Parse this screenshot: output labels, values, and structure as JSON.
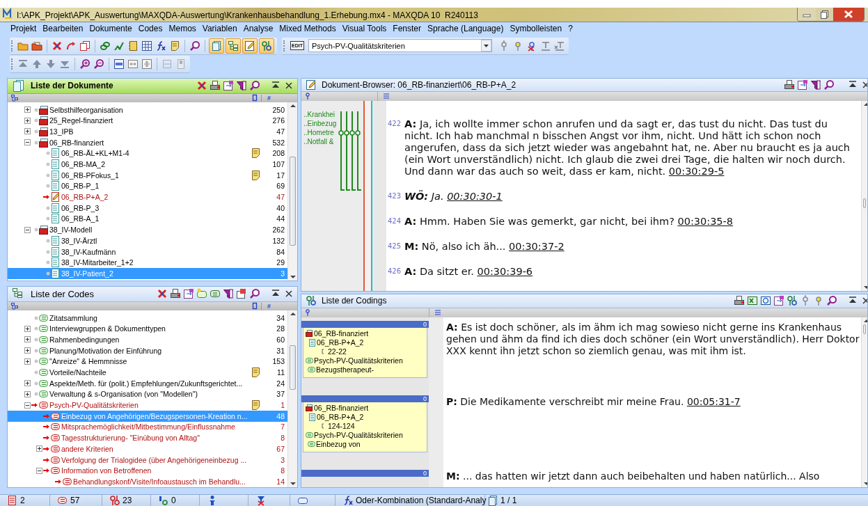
{
  "window": {
    "title": "I:\\APK_Projekt\\APK_Auswertung\\MAXQDA-Auswertung\\Krankenhausbehandlung_1.Erhebung.mx4 - MAXQDA 10  R240113"
  },
  "menu": [
    "Projekt",
    "Bearbeiten",
    "Dokumente",
    "Codes",
    "Memos",
    "Variablen",
    "Analyse",
    "Mixed Methods",
    "Visual Tools",
    "Fenster",
    "Sprache (Language)",
    "Symbolleisten",
    "?"
  ],
  "toolbar": {
    "window_toggles": [
      {
        "on": true
      },
      {
        "on": true
      },
      {
        "on": true
      },
      {
        "on": true
      }
    ],
    "code_badge": "EDIT",
    "code_dropdown": "Psych-PV-Qualitätskriterien"
  },
  "documents": {
    "title": "Liste der Dokumente",
    "count_header": "#",
    "items": [
      {
        "name": "Selbsthilfeorganisation",
        "count": "250",
        "kind": "set",
        "memo": false,
        "selected": false,
        "expanded": false
      },
      {
        "name": "25_Regel-finanziert",
        "count": "276",
        "kind": "set",
        "memo": false,
        "selected": false,
        "expanded": false
      },
      {
        "name": "13_IPB",
        "count": "47",
        "kind": "set",
        "memo": false,
        "selected": false,
        "expanded": false
      },
      {
        "name": "06_RB-finanziert",
        "count": "532",
        "kind": "set",
        "memo": false,
        "selected": false,
        "expanded": true,
        "children": [
          {
            "name": "06_RB-ÄL+KL+M1-4",
            "count": "208",
            "kind": "text",
            "memo": true,
            "selected": false
          },
          {
            "name": "06_RB-MA_2",
            "count": "107",
            "kind": "text",
            "memo": false,
            "selected": false
          },
          {
            "name": "06_RB-PFokus_1",
            "count": "17",
            "kind": "text",
            "memo": true,
            "selected": false
          },
          {
            "name": "06_RB-P_1",
            "count": "69",
            "kind": "text",
            "memo": false,
            "selected": false
          },
          {
            "name": "06_RB-P+A_2",
            "count": "47",
            "kind": "open",
            "memo": false,
            "selected": false
          },
          {
            "name": "06_RB-P_3",
            "count": "40",
            "kind": "text",
            "memo": false,
            "selected": false
          },
          {
            "name": "06_RB-A_1",
            "count": "44",
            "kind": "text",
            "memo": false,
            "selected": false
          }
        ]
      },
      {
        "name": "38_IV-Modell",
        "count": "262",
        "kind": "set",
        "memo": false,
        "selected": false,
        "expanded": true,
        "children": [
          {
            "name": "38_IV-Ärztl",
            "count": "132",
            "kind": "text",
            "memo": false,
            "selected": false
          },
          {
            "name": "38_IV-Kaufmänn",
            "count": "84",
            "kind": "text",
            "memo": false,
            "selected": false
          },
          {
            "name": "38_IV-Mitarbeiter_1+2",
            "count": "29",
            "kind": "text",
            "memo": false,
            "selected": false
          },
          {
            "name": "38_IV-Patient_2",
            "count": "3",
            "kind": "text",
            "memo": false,
            "selected": true
          }
        ]
      }
    ]
  },
  "codes": {
    "title": "Liste der Codes",
    "count_header": "#",
    "items": [
      {
        "name": "Zitatsammlung",
        "count": "34",
        "memo": false,
        "selected": false,
        "activated": false
      },
      {
        "name": "Interviewgruppen & Dokumenttypen",
        "count": "28",
        "memo": false,
        "selected": false,
        "activated": false,
        "expanded": false
      },
      {
        "name": "Rahmenbedingungen",
        "count": "60",
        "memo": false,
        "selected": false,
        "activated": false,
        "expanded": false
      },
      {
        "name": "Planung/Motivation der Einführung",
        "count": "31",
        "memo": false,
        "selected": false,
        "activated": false,
        "expanded": false
      },
      {
        "name": "\"Anreize\" & Hemmnisse",
        "count": "153",
        "memo": false,
        "selected": false,
        "activated": false,
        "expanded": false
      },
      {
        "name": "Vorteile/Nachteile",
        "count": "11",
        "memo": true,
        "selected": false,
        "activated": false
      },
      {
        "name": "Aspekte/Meth. für (polit.) Empfehlungen/Zukunftsgerichtet...",
        "count": "24",
        "memo": false,
        "selected": false,
        "activated": false,
        "expanded": false
      },
      {
        "name": "Verwaltung & s-Organisation (von \"Modellen\")",
        "count": "37",
        "memo": false,
        "selected": false,
        "activated": false,
        "expanded": false
      },
      {
        "name": "Psych-PV-Qualitätskriterien",
        "count": "1",
        "memo": true,
        "selected": false,
        "activated": true,
        "expanded": true,
        "children": [
          {
            "name": "Einbezug von Angehörigen/Bezugspersonen-Kreation n...",
            "count": "48",
            "memo": false,
            "selected": true,
            "activated": true
          },
          {
            "name": "Mitsprachemöglichkeit/Mitbestimmung/Einflussnahme",
            "count": "7",
            "memo": false,
            "selected": false,
            "activated": true
          },
          {
            "name": "Tagesstrukturierung- \"Einübung von Alltag\"",
            "count": "8",
            "memo": false,
            "selected": false,
            "activated": true
          },
          {
            "name": "andere Kriterien",
            "count": "67",
            "memo": false,
            "selected": false,
            "activated": true,
            "expanded": false
          },
          {
            "name": "Verfolgung der Trialogidee (über Angehörigeneinbezug ...",
            "count": "3",
            "memo": false,
            "selected": false,
            "activated": true
          },
          {
            "name": "Information von Betroffenen",
            "count": "8",
            "memo": false,
            "selected": false,
            "activated": true,
            "expanded": true,
            "children": [
              {
                "name": "Behandlungskonf/Visite/Infoaustausch im Behandlu...",
                "count": "14",
                "memo": false,
                "selected": false,
                "activated": true
              }
            ]
          }
        ]
      }
    ]
  },
  "browser": {
    "title": "Dokument-Browser: 06_RB-finanziert\\06_RB-P+A_2",
    "margin_codes": [
      "..Krankhei",
      "..Einbezug",
      "..Hometre",
      "..Notfall &"
    ],
    "paragraphs": [
      {
        "number": "422",
        "speaker": "A:",
        "text": "Ja, ich wollte immer schon anrufen und da sagt er, das tust du nicht. Das tust du nicht. Ich hab manchmal n bisschen Angst vor ihm, nicht. Und hätt ich schon noch angerufen, dass da sich jetzt wieder was angebahnt hat, ne. Aber nu braucht es ja auch (ein Wort unverständlich) nicht. Ich glaub die zwei drei Tage, die halten wir noch durch. Und dann war das auch so weit, dass er kam, nicht.",
        "timestamp": "00:30:29-5",
        "italic": false
      },
      {
        "number": "423",
        "speaker": "WÖ:",
        "text": "Ja.",
        "timestamp": "00:30:30-1",
        "italic": true
      },
      {
        "number": "424",
        "speaker": "A:",
        "text": "Hmm. Haben Sie was gemerkt, gar nicht, bei ihm?",
        "timestamp": "00:30:35-8",
        "italic": false
      },
      {
        "number": "425",
        "speaker": "M:",
        "text": "Nö, also ich äh...",
        "timestamp": "00:30:37-2",
        "italic": false
      },
      {
        "number": "426",
        "speaker": "A:",
        "text": "Da sitzt er.",
        "timestamp": "00:30:39-6",
        "italic": false
      }
    ]
  },
  "codings": {
    "title": "Liste der Codings",
    "items": [
      {
        "count": "0",
        "set": "06_RB-finanziert",
        "document": "06_RB-P+A_2",
        "range": "22-22",
        "code": "Psych-PV-Qualitätskriterien",
        "subcode": "Bezugstherapeut-",
        "speaker": "A:",
        "text": "Es ist doch schöner, als im ähm ich mag sowieso nicht gerne ins Krankenhaus gehen und ähm da find ich dies doch schöner (ein Wort unverständlich). Herr Doktor XXX kennt ihn jetzt schon so ziemlich genau, was mit ihm ist."
      },
      {
        "count": "0",
        "set": "06_RB-finanziert",
        "document": "06_RB-P+A_2",
        "range": "124-124",
        "code": "Psych-PV-Qualitätskriterien",
        "subcode": "Einbezug von",
        "speaker": "P:",
        "text": "Die Medikamente verschreibt mir meine Frau.",
        "timestamp": "00:05:31-7"
      },
      {
        "count": "0",
        "speaker": "M:",
        "text": "... das hatten wir jetzt dann auch beibehalten und haben natürlich... Also"
      }
    ]
  },
  "status_bar": {
    "counts": [
      {
        "kind": "documents",
        "value": "2"
      },
      {
        "kind": "codes",
        "value": "57"
      },
      {
        "kind": "codings",
        "value": "23"
      },
      {
        "kind": "weights",
        "value": "0"
      }
    ],
    "mode": "Oder-Kombination (Standard-Analy",
    "pages": "1 / 1"
  }
}
